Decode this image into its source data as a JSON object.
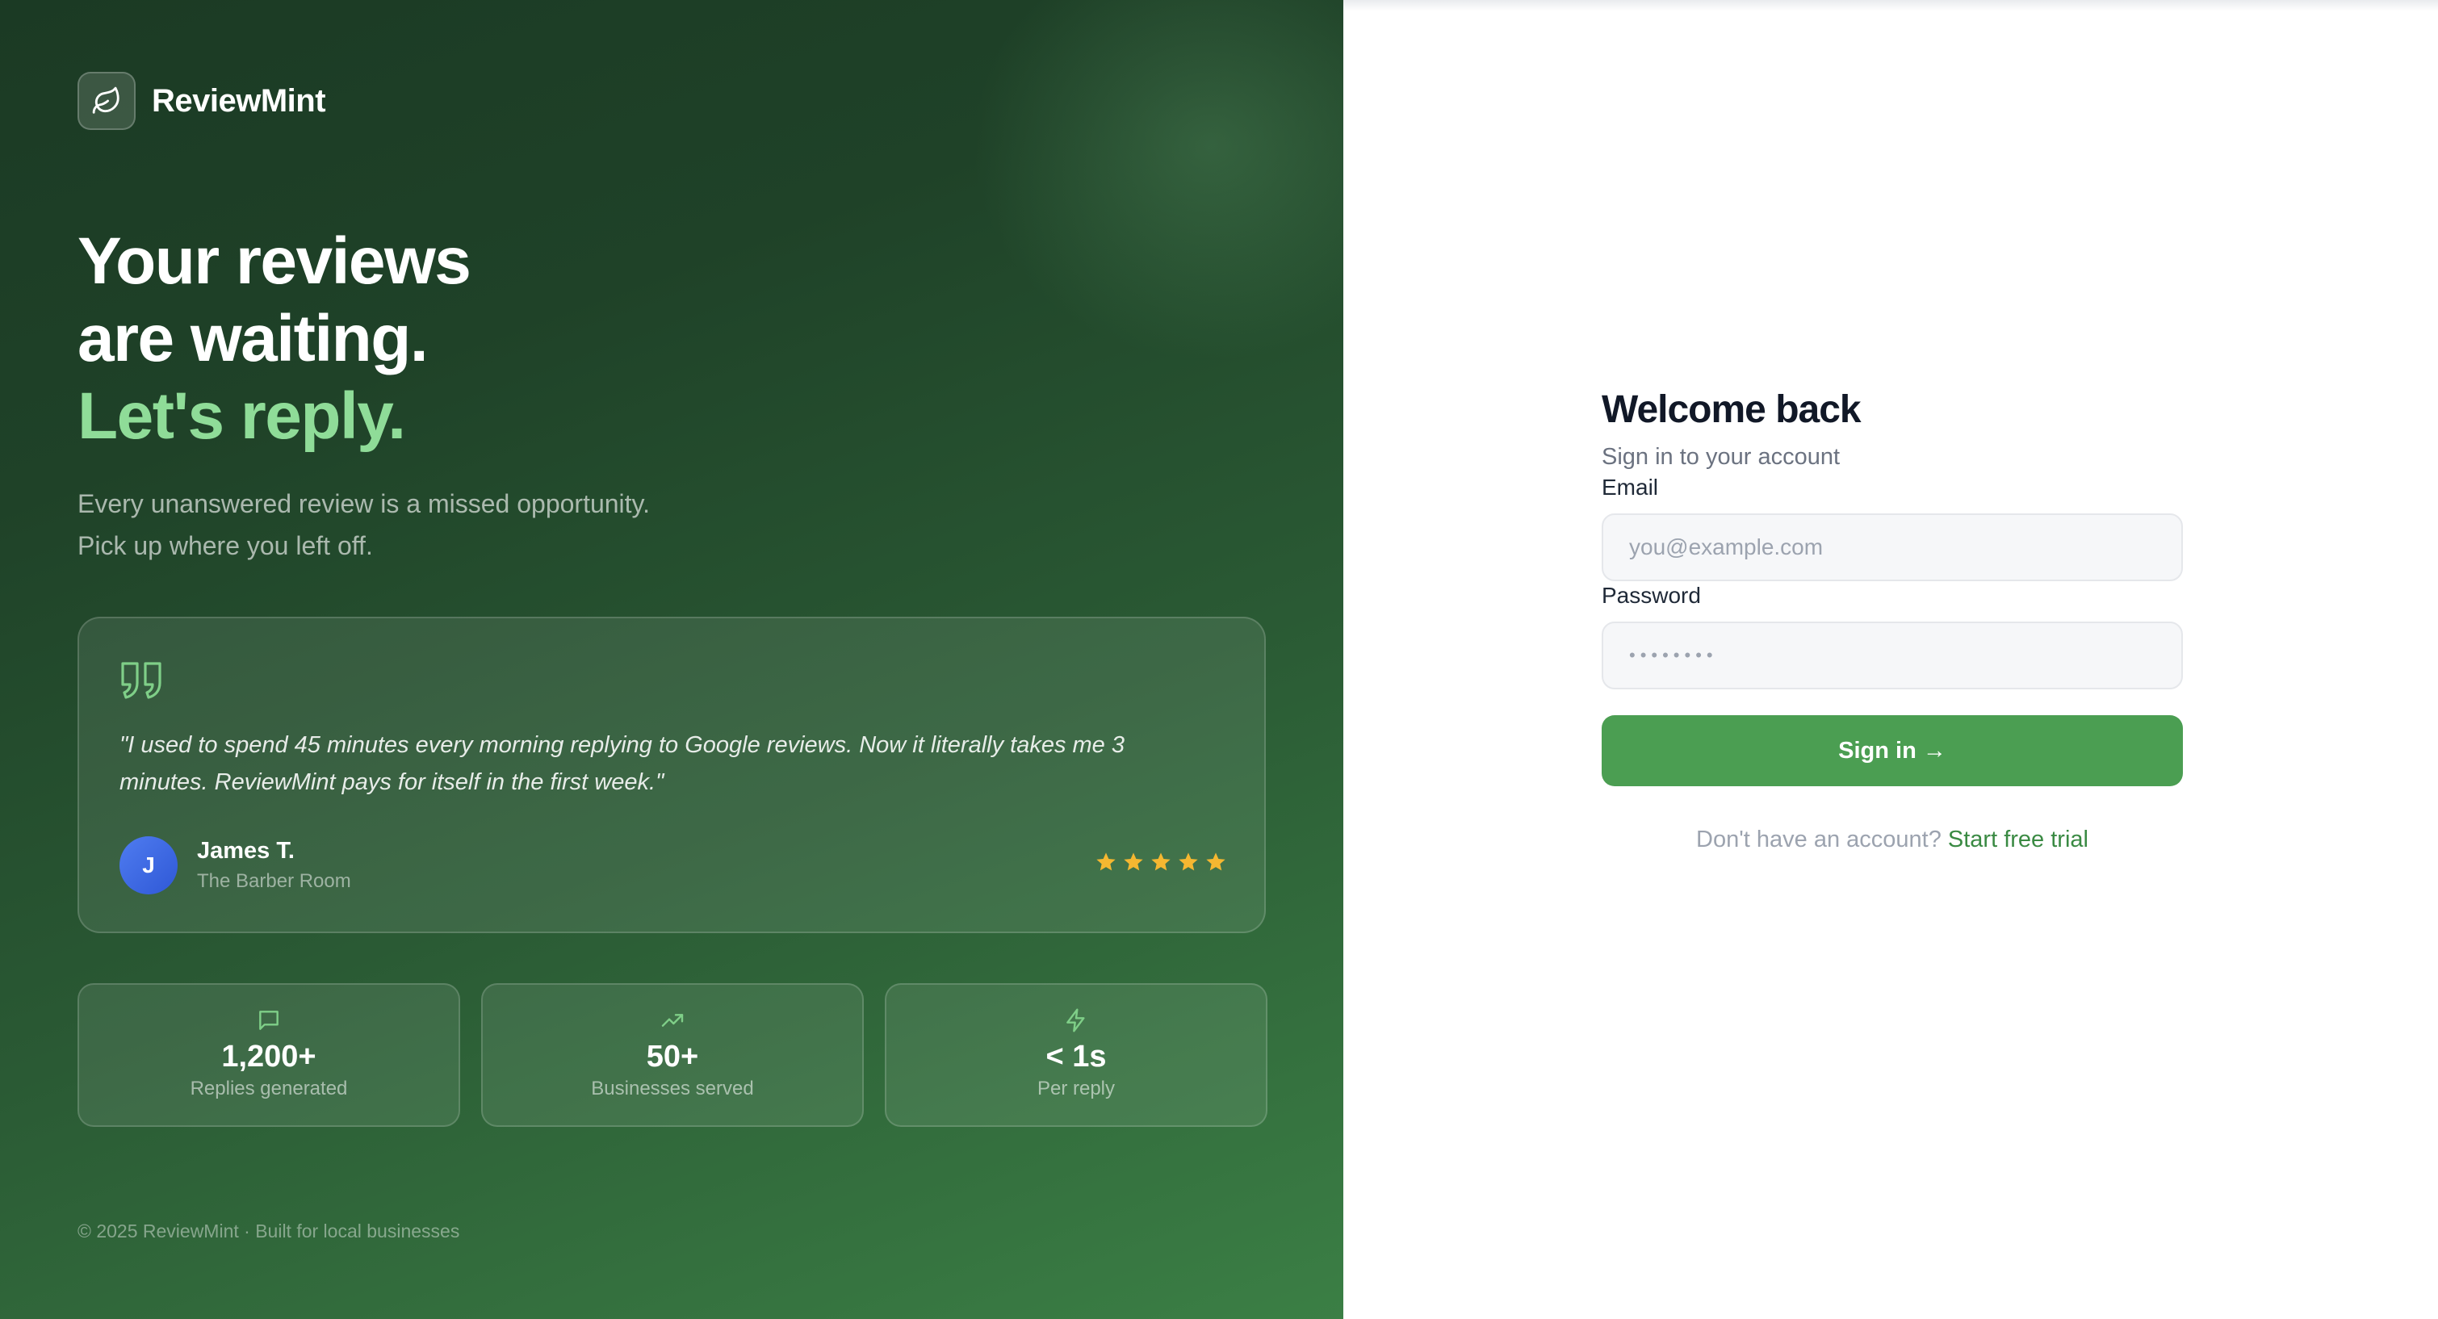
{
  "brand": {
    "name": "ReviewMint",
    "icon": "leaf-icon"
  },
  "hero": {
    "line1": "Your reviews",
    "line2": "are waiting.",
    "line3": "Let's reply.",
    "sub1": "Every unanswered review is a missed opportunity.",
    "sub2": "Pick up where you left off."
  },
  "testimonial": {
    "quote": "\"I used to spend 45 minutes every morning replying to Google reviews. Now it literally takes me 3 minutes. ReviewMint pays for itself in the first week.\"",
    "author_initial": "J",
    "author_name": "James T.",
    "author_business": "The Barber Room",
    "rating": 5
  },
  "stats": [
    {
      "icon": "chat-bubble-icon",
      "value": "1,200+",
      "label": "Replies generated"
    },
    {
      "icon": "trending-up-icon",
      "value": "50+",
      "label": "Businesses served"
    },
    {
      "icon": "lightning-icon",
      "value": "< 1s",
      "label": "Per reply"
    }
  ],
  "footer": "© 2025 ReviewMint · Built for local businesses",
  "form": {
    "title": "Welcome back",
    "subtitle": "Sign in to your account",
    "email_label": "Email",
    "email_placeholder": "you@example.com",
    "password_label": "Password",
    "password_placeholder": "••••••••",
    "submit_label": "Sign in →",
    "signup_prompt": "Don't have an account?",
    "signup_link": "Start free trial"
  },
  "colors": {
    "accent": "#4b9e52",
    "highlight": "#8fdc98",
    "star": "#f5b731"
  }
}
